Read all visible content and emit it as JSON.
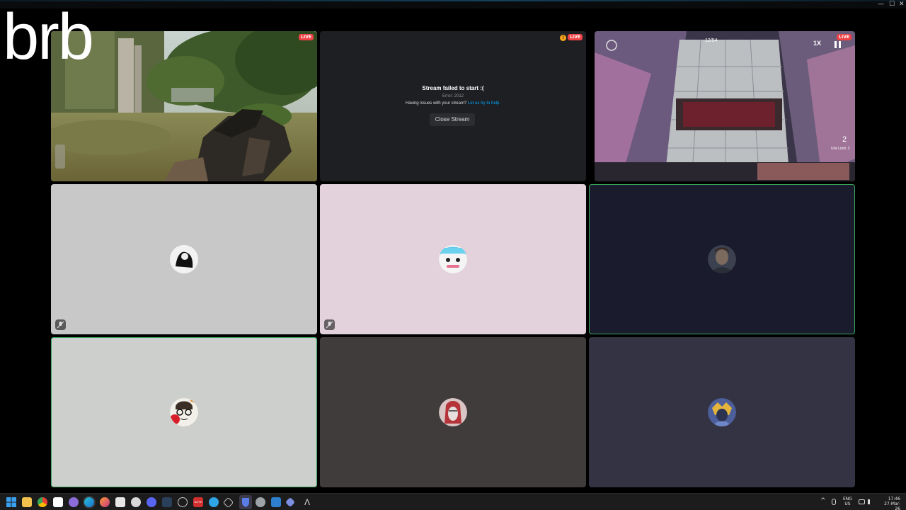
{
  "overlay": {
    "text": "brb"
  },
  "tiles": {
    "fps": {
      "live_badge": "LIVE"
    },
    "failed": {
      "live_badge": "LIVE",
      "warning_glyph": "!",
      "title": "Stream failed to start :(",
      "error_text": "Error: 2012",
      "help_text": "Having issues with your stream?",
      "help_link": "Let us try to help.",
      "close_button": "Close Stream"
    },
    "game": {
      "live_badge": "LIVE",
      "cost": "12/54",
      "speed": "1X",
      "deploy_count": "2",
      "unit_limit": "Unit Limit: 3"
    },
    "participants": [
      {
        "id": "p1",
        "bg": "#c8c8c8",
        "muted": true,
        "speaking": false,
        "avatar": "monochrome-figure"
      },
      {
        "id": "p2",
        "bg": "#e3d2db",
        "muted": true,
        "speaking": false,
        "avatar": "blue-hair-face"
      },
      {
        "id": "p3",
        "bg": "#1a1b2c",
        "muted": false,
        "speaking": true,
        "avatar": "man-portrait"
      },
      {
        "id": "p4",
        "bg": "#cdcfcd",
        "muted": false,
        "speaking": true,
        "avatar": "glasses-face-red-balloon"
      },
      {
        "id": "p5",
        "bg": "#403c3c",
        "muted": false,
        "speaking": false,
        "avatar": "red-knight"
      },
      {
        "id": "p6",
        "bg": "#333343",
        "muted": false,
        "speaking": false,
        "avatar": "blue-gold-character"
      }
    ]
  },
  "window_controls": {
    "minimize": "—",
    "maximize": "☐",
    "close": "✕"
  },
  "taskbar": {
    "lang_top": "ENG",
    "lang_bottom": "US",
    "time": "17:46",
    "date": "27-Mar-26",
    "chevron": "^",
    "notification_badge": "NOTE"
  },
  "colors": {
    "live": "#ed4245",
    "speaking": "#3ba55d",
    "link": "#00a8fc",
    "warning": "#faa61a"
  }
}
